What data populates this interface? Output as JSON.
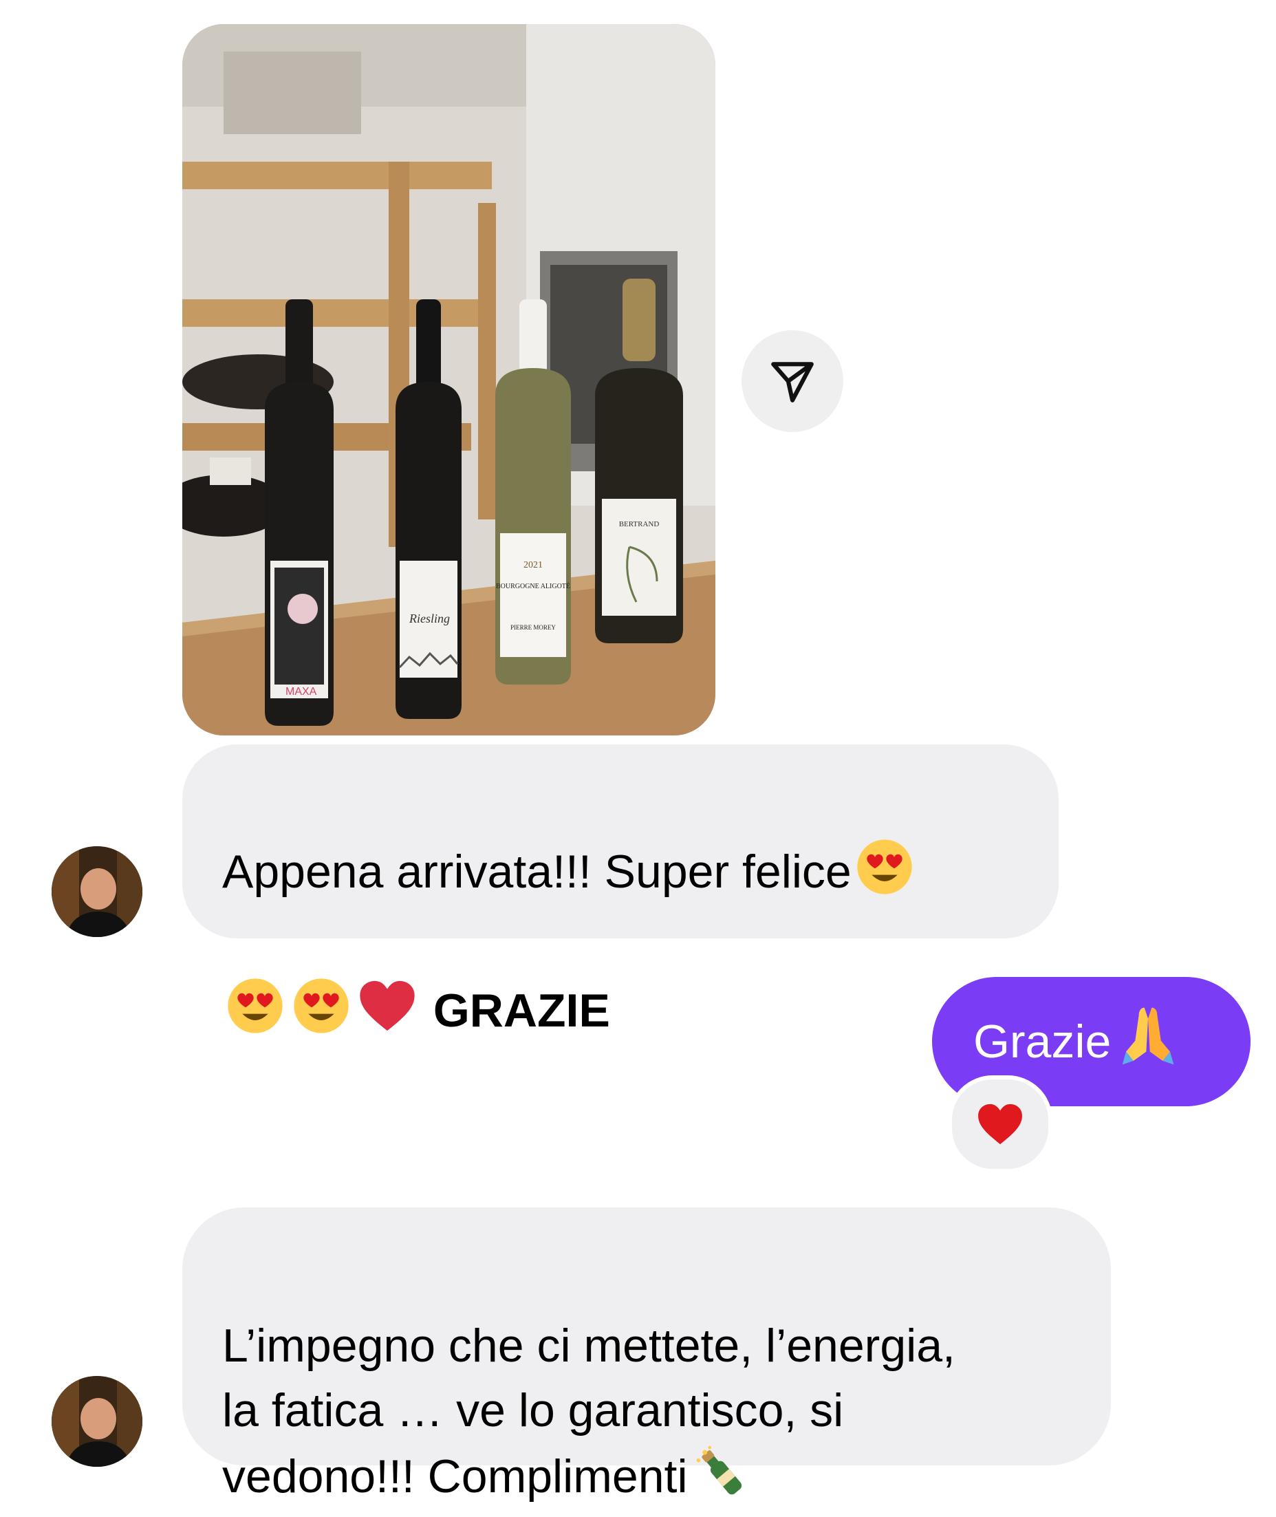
{
  "thread": {
    "photo": {
      "icon": "photo-wine-bottles",
      "bottles": [
        {
          "label_text": "MAXA"
        },
        {
          "label_text": "Riesling"
        },
        {
          "label_text": "BOURGOGNE ALIGOTÉ",
          "sub_text": "PIERRE MOREY",
          "vintage": "2021"
        },
        {
          "label_text": "BERTRAND"
        }
      ]
    },
    "share_button": {
      "icon": "send-icon"
    },
    "messages": [
      {
        "sender": "them",
        "line1": "Appena arrivata!!! Super felice",
        "line2": "GRAZIE",
        "emojis": [
          "heart-eyes",
          "heart-eyes",
          "heart-eyes",
          "red-heart"
        ]
      },
      {
        "sender": "me",
        "text": "Grazie",
        "emojis": [
          "folded-hands"
        ],
        "reaction": "red-heart"
      },
      {
        "sender": "them",
        "text": "L’impegno che ci mettete, l’energia,\nla fatica … ve lo garantisco, si\nvedono!!! Complimenti",
        "emojis": [
          "champagne-bottle"
        ]
      }
    ],
    "colors": {
      "incoming_bubble": "#efeff1",
      "outgoing_bubble": "#7a3cf5",
      "reaction_heart": "#e0191f"
    }
  }
}
